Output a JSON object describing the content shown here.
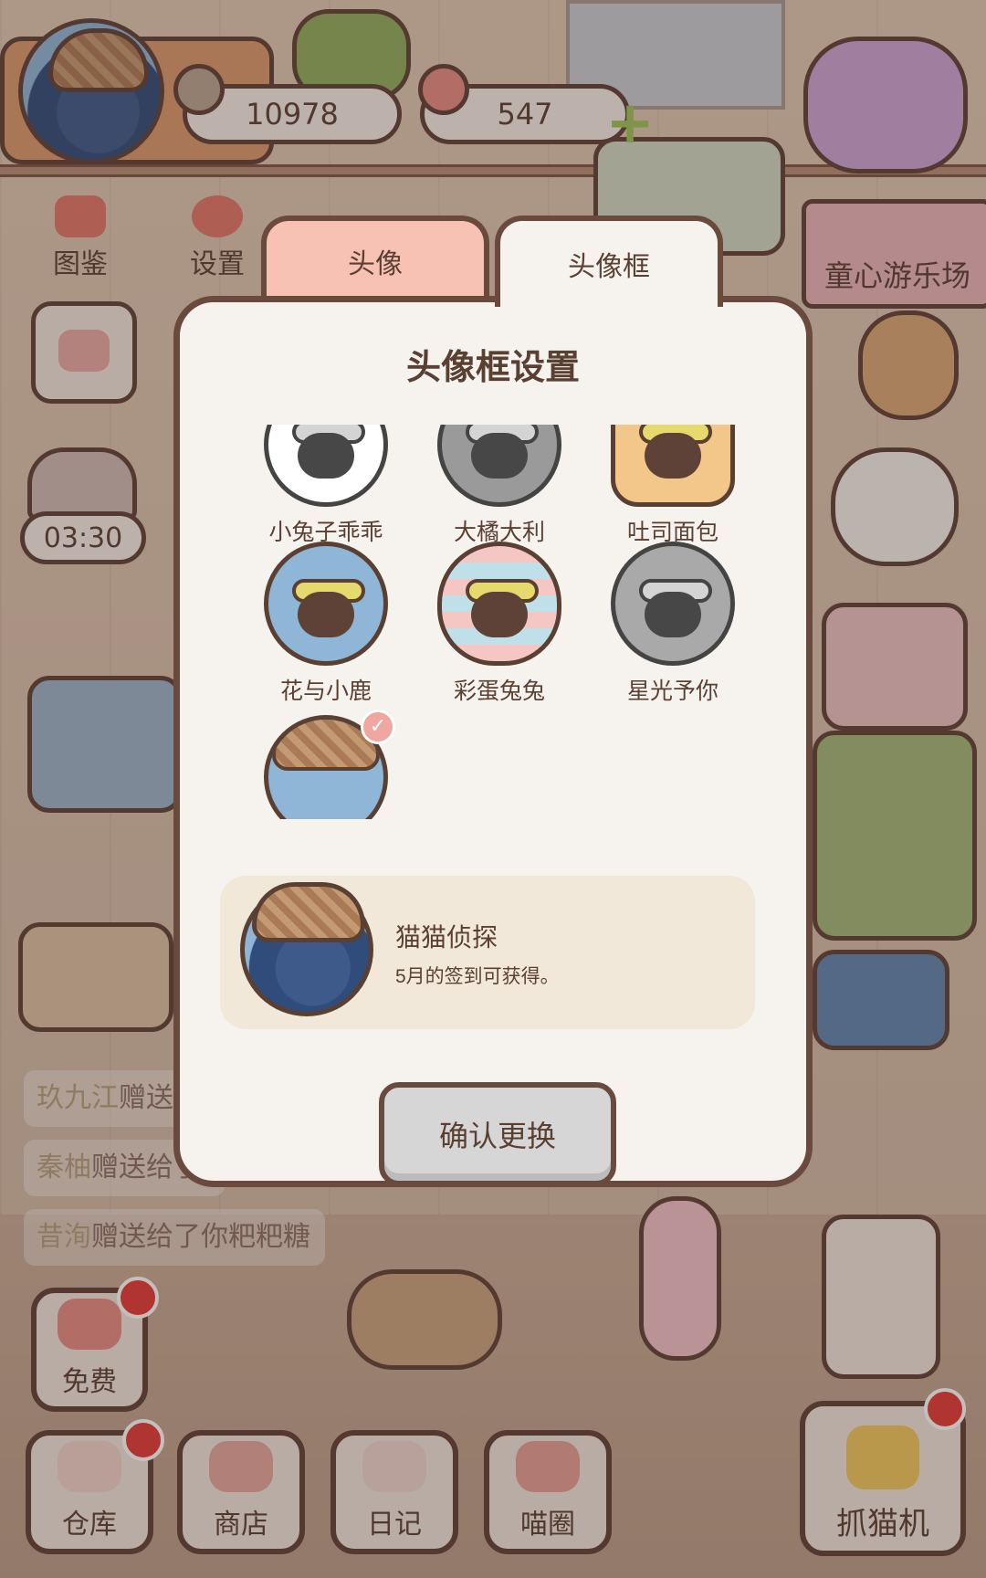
{
  "hud": {
    "coins": "10978",
    "hearts": "547",
    "timer": "03:30",
    "side_buttons": {
      "atlas": "图鉴",
      "settings": "设置"
    },
    "banner": "童心游乐场"
  },
  "gift_log": [
    {
      "name": "玖九江",
      "text": "赠送"
    },
    {
      "name": "秦柚",
      "text": "赠送给了"
    },
    {
      "name": "昔洵",
      "text": "赠送给了你粑粑糖"
    }
  ],
  "bottom_nav": {
    "free": "免费",
    "warehouse": "仓库",
    "shop": "商店",
    "diary": "日记",
    "meow_circle": "喵圈",
    "claw_machine": "抓猫机"
  },
  "modal": {
    "tabs": [
      {
        "label": "头像",
        "active": false
      },
      {
        "label": "头像框",
        "active": true
      }
    ],
    "title": "头像框设置",
    "frames": [
      {
        "label": "小兔子乖乖",
        "owned": false,
        "color": "#ffffff"
      },
      {
        "label": "大橘大利",
        "owned": false,
        "color": "#9a9a9a"
      },
      {
        "label": "吐司面包",
        "owned": true,
        "color": "#f3c68a"
      },
      {
        "label": "花与小鹿",
        "owned": true,
        "color": "#8fb6d7"
      },
      {
        "label": "彩蛋兔兔",
        "owned": true,
        "color": "#f4c7c4"
      },
      {
        "label": "星光予你",
        "owned": false,
        "color": "#a9a9a9"
      },
      {
        "label": "",
        "owned": true,
        "selected": true,
        "color": "#8fb6d7"
      }
    ],
    "selected_detail": {
      "name": "猫猫侦探",
      "description": "5月的签到可获得。"
    },
    "confirm_label": "确认更换"
  }
}
